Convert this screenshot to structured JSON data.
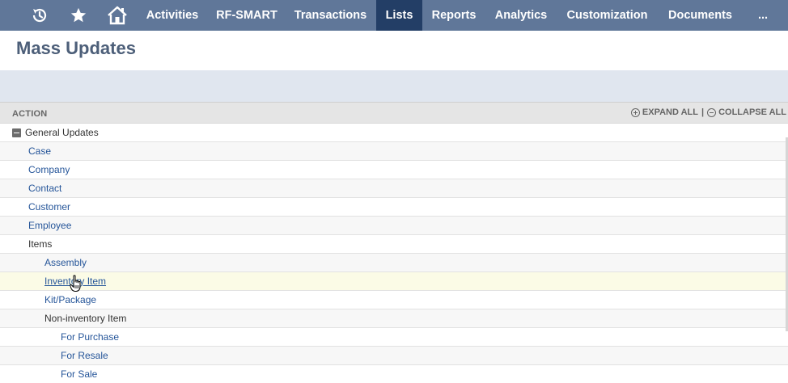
{
  "nav": {
    "icons": [
      "recent-records-icon",
      "star-icon",
      "home-icon"
    ],
    "items": [
      {
        "label": "Activities",
        "active": false
      },
      {
        "label": "RF-SMART",
        "active": false
      },
      {
        "label": "Transactions",
        "active": false
      },
      {
        "label": "Lists",
        "active": true
      },
      {
        "label": "Reports",
        "active": false
      },
      {
        "label": "Analytics",
        "active": false
      },
      {
        "label": "Customization",
        "active": false
      },
      {
        "label": "Documents",
        "active": false
      },
      {
        "label": "...",
        "active": false
      }
    ]
  },
  "page": {
    "title": "Mass Updates"
  },
  "table": {
    "action_header": "ACTION",
    "expand_all": "EXPAND ALL",
    "separator": "|",
    "collapse_all": "COLLAPSE ALL",
    "rows": [
      {
        "label": "General Updates",
        "level": 0,
        "link": false,
        "collapsible": true
      },
      {
        "label": "Case",
        "level": 1,
        "link": true
      },
      {
        "label": "Company",
        "level": 1,
        "link": true
      },
      {
        "label": "Contact",
        "level": 1,
        "link": true
      },
      {
        "label": "Customer",
        "level": 1,
        "link": true
      },
      {
        "label": "Employee",
        "level": 1,
        "link": true
      },
      {
        "label": "Items",
        "level": 1,
        "link": false
      },
      {
        "label": "Assembly",
        "level": 2,
        "link": true
      },
      {
        "label": "Inventory Item",
        "level": 2,
        "link": true,
        "hovered": true
      },
      {
        "label": "Kit/Package",
        "level": 2,
        "link": true
      },
      {
        "label": "Non-inventory Item",
        "level": 2,
        "link": false
      },
      {
        "label": "For Purchase",
        "level": 3,
        "link": true
      },
      {
        "label": "For Resale",
        "level": 3,
        "link": true
      },
      {
        "label": "For Sale",
        "level": 3,
        "link": true
      }
    ]
  },
  "colors": {
    "nav_bg": "#607799",
    "nav_active": "#233e66",
    "link": "#255599",
    "title": "#4d5f79"
  }
}
